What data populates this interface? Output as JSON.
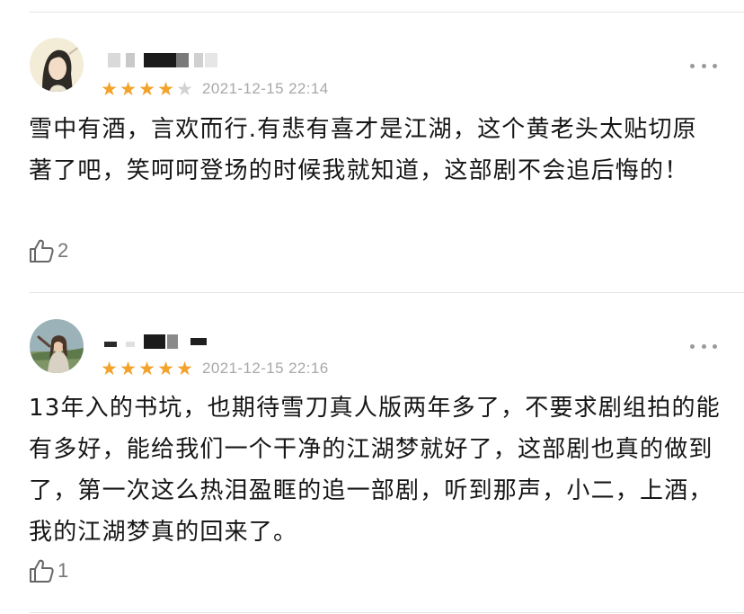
{
  "comments": [
    {
      "avatar_icon": "avatar-woman-long-hair",
      "rating": 4,
      "max_rating": 5,
      "stars": [
        "★",
        "★",
        "★",
        "★",
        "★"
      ],
      "timestamp": "2021-12-15 22:14",
      "text": "雪中有酒，言欢而行.有悲有喜才是江湖，这个黄老头太贴切原著了吧，笑呵呵登场的时候我就知道，这部剧不会追后悔的！",
      "likes": "2",
      "more_icon": "more-dots-icon",
      "like_icon": "thumbs-up-icon"
    },
    {
      "avatar_icon": "avatar-girl-outdoor",
      "rating": 5,
      "max_rating": 5,
      "stars": [
        "★",
        "★",
        "★",
        "★",
        "★"
      ],
      "timestamp": "2021-12-15 22:16",
      "text": "13年入的书坑，也期待雪刀真人版两年多了，不要求剧组拍的能有多好，能给我们一个干净的江湖梦就好了，这部剧也真的做到了，第一次这么热泪盈眶的追一部剧，听到那声，小二，上酒，我的江湖梦真的回来了。",
      "likes": "1",
      "more_icon": "more-dots-icon",
      "like_icon": "thumbs-up-icon"
    }
  ],
  "colors": {
    "star_active": "#f3a22a",
    "star_inactive": "#d2d2d2",
    "timestamp": "#a8a8a8",
    "text": "#161616"
  }
}
